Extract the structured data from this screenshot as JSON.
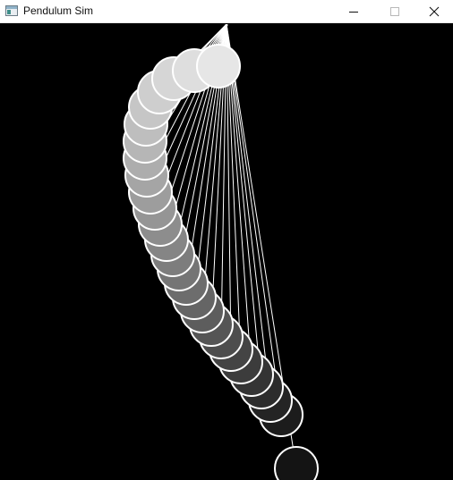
{
  "window": {
    "title": "Pendulum Sim",
    "icon": "app-window-icon",
    "controls": {
      "minimize_icon": "minimize-icon",
      "maximize_icon": "maximize-icon",
      "close_icon": "close-icon"
    }
  },
  "scene": {
    "background": "#000000",
    "rope_color": "#ffffff",
    "bob_outline": "#ffffff",
    "bob_fill_lightest": "#e6e6e6",
    "bob_fill_darkest": "#141414",
    "bob_count": 27
  }
}
